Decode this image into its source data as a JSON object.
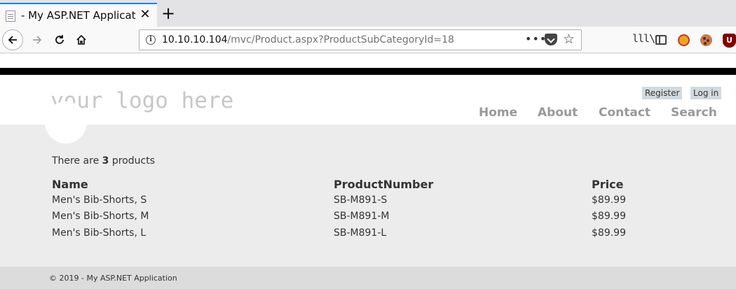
{
  "browser": {
    "tab_title": "- My ASP.NET Applicatio",
    "tab_close_glyph": "✕",
    "new_tab_glyph": "+",
    "url_host": "10.10.10.104",
    "url_path": "/mvc/Product.aspx?ProductSubCategoryId=18",
    "url_more_glyph": "•••",
    "star_glyph": "☆",
    "library_glyph": "lll\\",
    "ext3_label": "U",
    "icons": [
      "back-arrow-icon",
      "forward-arrow-icon",
      "reload-icon",
      "home-icon",
      "info-icon",
      "pocket-icon",
      "star-icon",
      "library-icon",
      "sidebar-icon",
      "extension-icon",
      "cookie-icon",
      "ublock-icon"
    ]
  },
  "site": {
    "logo": "your logo here",
    "register_label": "Register",
    "login_label": "Log in",
    "menu": [
      "Home",
      "About",
      "Contact",
      "Search"
    ]
  },
  "products": {
    "count_prefix": "There are ",
    "count": "3",
    "count_suffix": " products",
    "columns": [
      "Name",
      "ProductNumber",
      "Price"
    ],
    "rows": [
      [
        "Men's Bib-Shorts, S",
        "SB-M891-S",
        "$89.99"
      ],
      [
        "Men's Bib-Shorts, M",
        "SB-M891-M",
        "$89.99"
      ],
      [
        "Men's Bib-Shorts, L",
        "SB-M891-L",
        "$89.99"
      ]
    ]
  },
  "footer": {
    "text": "© 2019 - My ASP.NET Application"
  }
}
